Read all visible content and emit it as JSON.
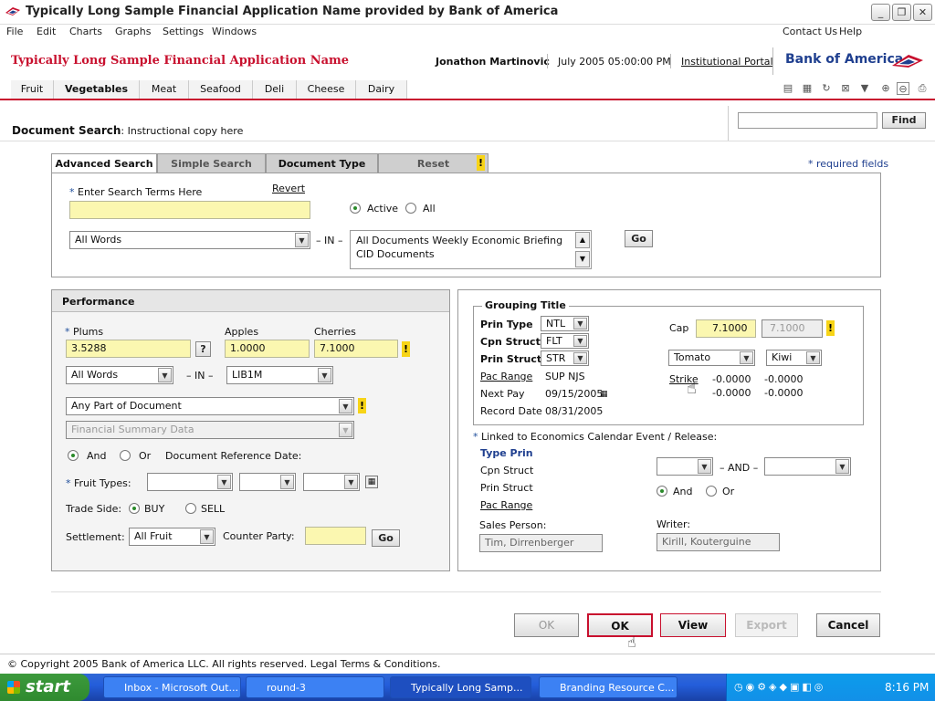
{
  "window": {
    "title": "Typically Long Sample Financial Application Name provided by Bank of America",
    "buttons": {
      "minimize": "_",
      "restore": "❐",
      "close": "✕"
    }
  },
  "menu": {
    "items": [
      "File",
      "Edit",
      "Charts",
      "Graphs",
      "Settings",
      "Windows"
    ],
    "right": [
      "Contact Us",
      "Help"
    ]
  },
  "header": {
    "app_title": "Typically Long Sample Financial Application Name",
    "user": "Jonathon Martinovic",
    "datetime": "July 2005  05:00:00 PM",
    "portal_link": "Institutional Portal",
    "brand": "Bank of America"
  },
  "nav_tabs": [
    "Fruit",
    "Vegetables",
    "Meat",
    "Seafood",
    "Deli",
    "Cheese",
    "Dairy"
  ],
  "nav_active": "Vegetables",
  "doc_search": {
    "title": "Document Search",
    "instruction": ": Instructional copy here",
    "find_label": "Find",
    "find_value": ""
  },
  "search_tabs": [
    "Advanced Search",
    "Simple Search",
    "Document Type",
    "Reset"
  ],
  "required_note": "* required fields",
  "search": {
    "terms_label": "Enter Search Terms Here",
    "revert": "Revert",
    "terms_value": "",
    "status_options": [
      "Active",
      "All"
    ],
    "status_selected": "Active",
    "words_select": "All Words",
    "in_label": "– IN –",
    "doc_list": [
      "All Documents Weekly Economic Briefing",
      "CID  Documents"
    ],
    "go": "Go"
  },
  "performance": {
    "title": "Performance",
    "plums_label": "Plums",
    "plums_value": "3.5288",
    "help": "?",
    "apples_label": "Apples",
    "apples_value": "1.0000",
    "cherries_label": "Cherries",
    "cherries_value": "7.1000",
    "words_select": "All Words",
    "in_label": "– IN –",
    "lib_select": "LIB1M",
    "part_select": "Any Part of Document",
    "financial_select": "Financial Summary Data",
    "and_or": [
      "And",
      "Or"
    ],
    "and_or_selected": "And",
    "doc_ref_date": "Document Reference Date:",
    "fruit_types_label": "Fruit Types:",
    "trade_side_label": "Trade Side:",
    "trade_side": [
      "BUY",
      "SELL"
    ],
    "trade_side_selected": "BUY",
    "settlement_label": "Settlement:",
    "settlement_select": "All Fruit",
    "counter_party_label": "Counter Party:",
    "counter_party_value": "",
    "go": "Go"
  },
  "grouping": {
    "title": "Grouping Title",
    "prin_type_label": "Prin Type",
    "prin_type_value": "NTL",
    "cpn_struct_label": "Cpn Struct",
    "cpn_struct_value": "FLT",
    "prin_struct_label": "Prin Struct",
    "prin_struct_value": "STR",
    "pac_range_label": "Pac Range",
    "pac_range_value": "SUP  NJS",
    "next_pay_label": "Next Pay",
    "next_pay_value": "09/15/2005",
    "record_date_label": "Record Date",
    "record_date_value": "08/31/2005",
    "cap_label": "Cap",
    "cap_value": "7.1000",
    "cap_value2": "7.1000",
    "select_a": "Tomato",
    "select_b": "Kiwi",
    "strike_label": "Strike",
    "strike_values": [
      "-0.0000",
      "-0.0000",
      "-0.0000",
      "-0.0000"
    ]
  },
  "linked": {
    "title": "Linked to Economics Calendar Event / Release:",
    "type_prin": "Type Prin",
    "cpn_struct": "Cpn Struct",
    "prin_struct": "Prin Struct",
    "pac_range": "Pac Range",
    "and_label": "– AND –",
    "and_or": [
      "And",
      "Or"
    ],
    "and_or_selected": "And",
    "sales_person_label": "Sales Person:",
    "sales_person_value": "Tim, Dirrenberger",
    "writer_label": "Writer:",
    "writer_value": "Kirill, Kouterguine"
  },
  "actions": [
    "OK",
    "OK",
    "View",
    "Export",
    "Cancel"
  ],
  "footer": "© Copyright 2005 Bank of America LLC. All rights reserved. Legal Terms & Conditions.",
  "taskbar": {
    "start": "start",
    "tasks": [
      "Inbox - Microsoft Out...",
      "round-3",
      "Typically Long  Samp...",
      "Branding Resource C..."
    ],
    "clock": "8:16 PM"
  },
  "colors": {
    "brand_red": "#c8102e",
    "brand_blue": "#1f3f8f",
    "field_yellow": "#fbf7b0",
    "warn_yellow": "#f7d417"
  }
}
